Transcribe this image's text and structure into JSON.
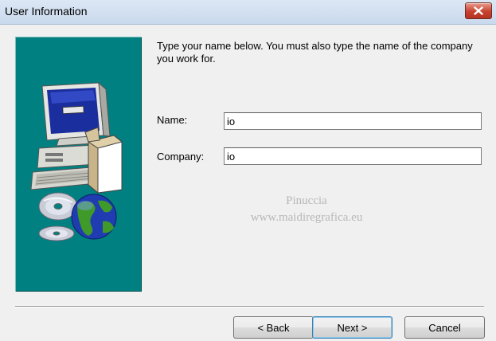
{
  "window": {
    "title": "User Information",
    "close_icon": "close-icon",
    "close_color": "#c8412f"
  },
  "side_panel": {
    "background": "#008080",
    "illustration": [
      "computer-icon",
      "cd-disc-icon",
      "globe-icon"
    ]
  },
  "instructions": "Type your name below. You must also type the name of the company you work for.",
  "form": {
    "name_label": "Name:",
    "name_value": "io",
    "company_label": "Company:",
    "company_value": "io"
  },
  "watermark": {
    "line1": "Pinuccia",
    "line2": "www.maidiregrafica.eu"
  },
  "buttons": {
    "back": "< Back",
    "next": "Next >",
    "cancel": "Cancel"
  }
}
